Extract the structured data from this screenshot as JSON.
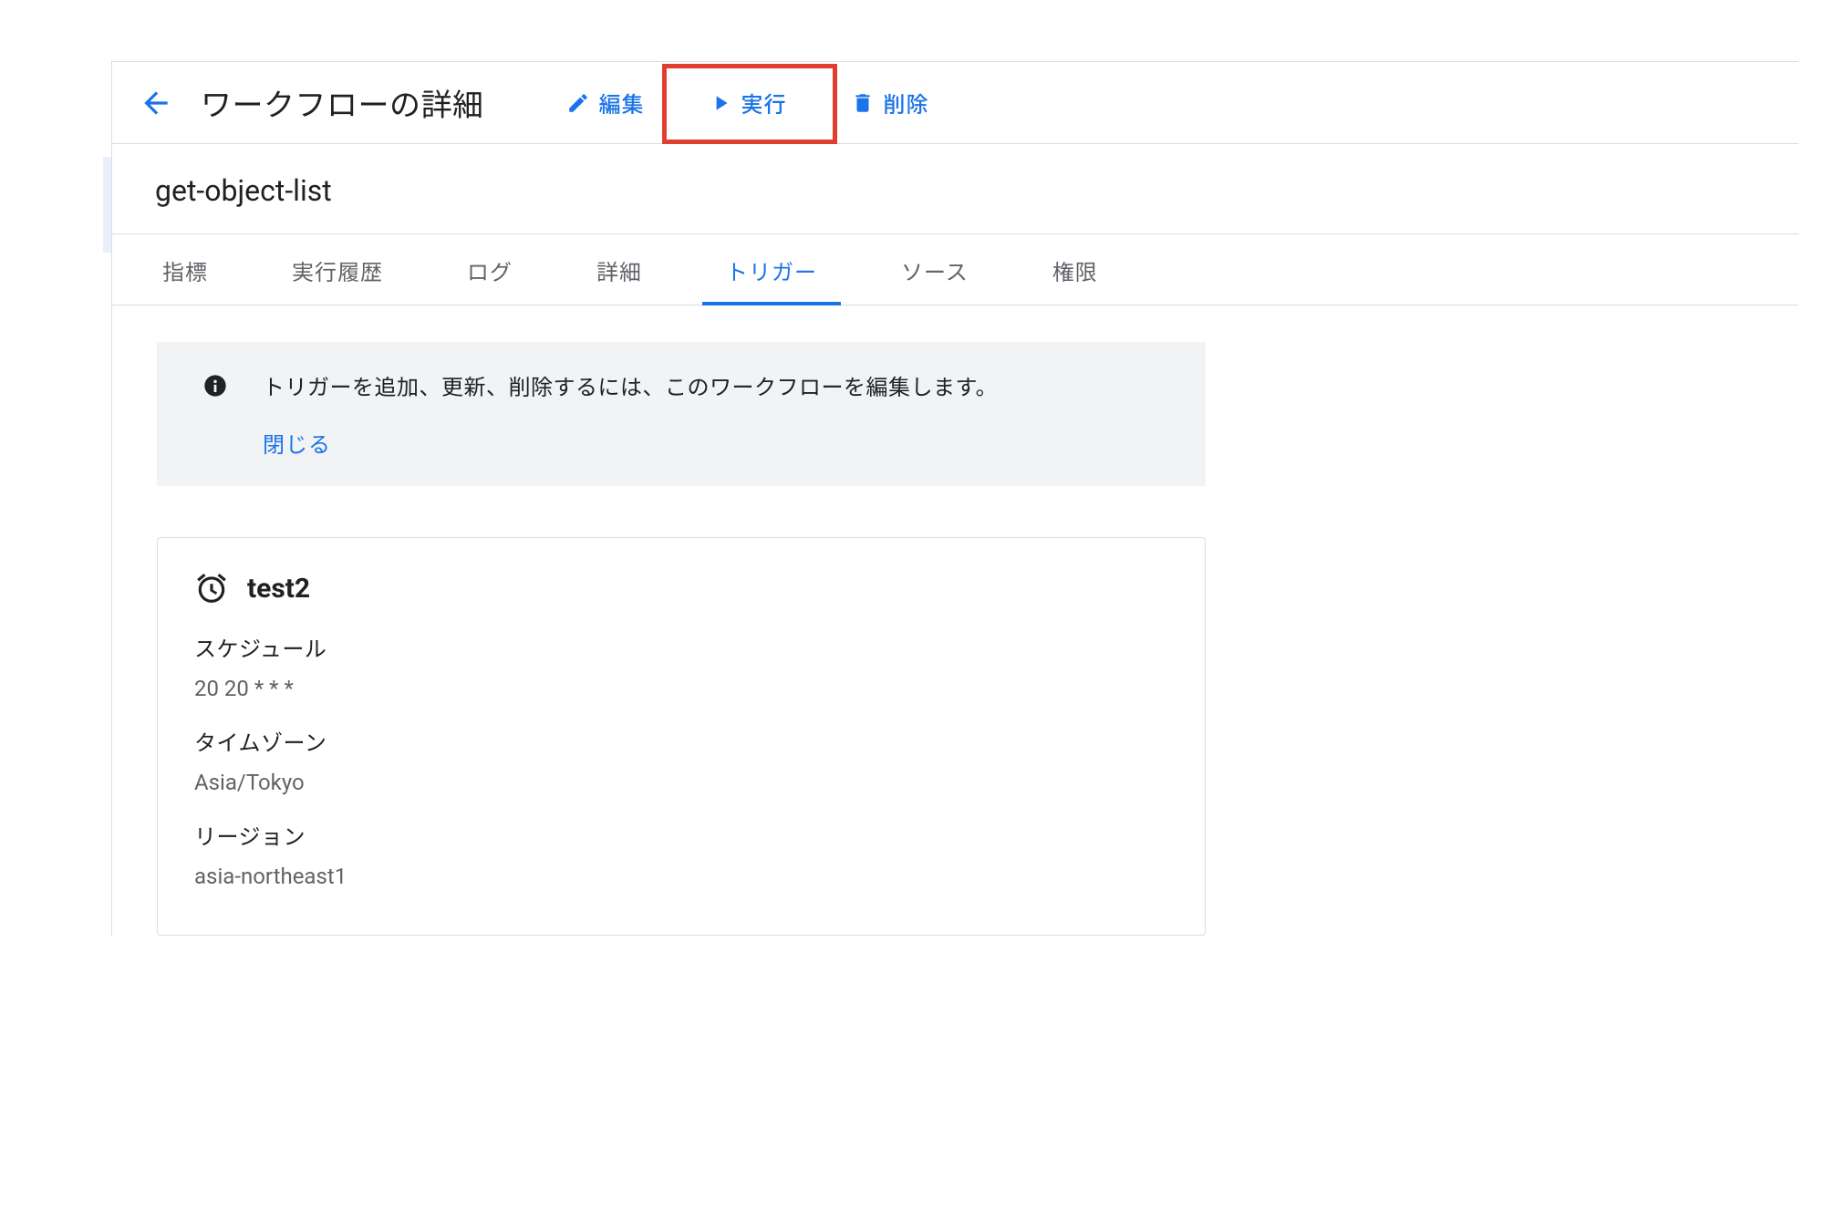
{
  "header": {
    "title": "ワークフローの詳細",
    "actions": {
      "edit": "編集",
      "run": "実行",
      "delete": "削除"
    }
  },
  "workflow": {
    "name": "get-object-list"
  },
  "tabs": {
    "metrics": "指標",
    "history": "実行履歴",
    "logs": "ログ",
    "details": "詳細",
    "triggers": "トリガー",
    "source": "ソース",
    "permissions": "権限"
  },
  "info": {
    "message": "トリガーを追加、更新、削除するには、このワークフローを編集します。",
    "close": "閉じる"
  },
  "trigger": {
    "name": "test2",
    "schedule_label": "スケジュール",
    "schedule_value": "20 20 * * *",
    "timezone_label": "タイムゾーン",
    "timezone_value": "Asia/Tokyo",
    "region_label": "リージョン",
    "region_value": "asia-northeast1"
  }
}
